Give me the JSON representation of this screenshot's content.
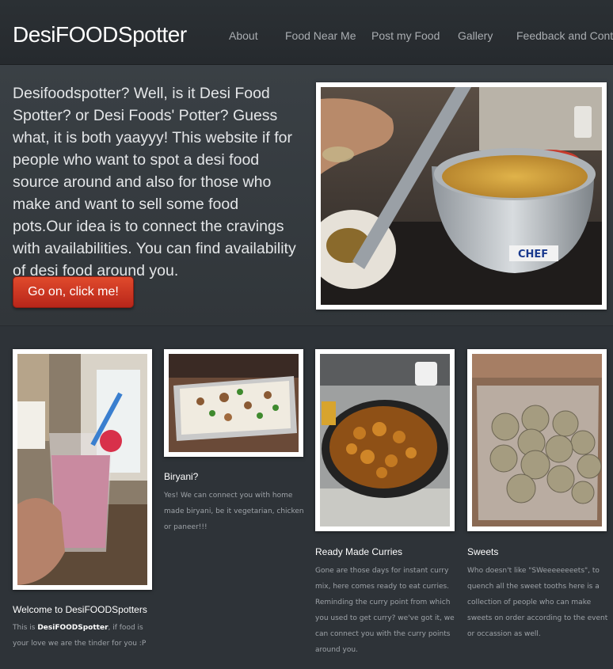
{
  "site": {
    "logo": "DesiFOODSpotter"
  },
  "nav": [
    {
      "label": "About"
    },
    {
      "label": "Food Near Me"
    },
    {
      "label": "Post my Food"
    },
    {
      "label": "Gallery"
    },
    {
      "label": "Feedback and Contact"
    }
  ],
  "banner": {
    "text": "Desifoodspotter? Well, is it Desi Food Spotter? or Desi Foods' Potter? Guess what, it is both yaayyy! This website if for people who want to spot a desi food source around and also for those who make and want to sell some food pots.Our idea is to connect the cravings with availabilities. You can find availability of desi food around you.",
    "button_label": "Go on, click me!",
    "photo_caption": "CHEF"
  },
  "cards": [
    {
      "title": "Welcome to DesiFOODSpotters",
      "text_before": "This is ",
      "text_bold": "DesiFOODSpotter",
      "text_after": ", if food is your love we are the tinder for you :P"
    },
    {
      "title": "Biryani?",
      "text": "Yes! We can connect you with home made biryani, be it vegetarian, chicken or paneer!!!"
    },
    {
      "title": "Ready Made Curries",
      "text": "Gone are those days for instant curry mix, here comes ready to eat curries. Reminding the curry point from which you used to get curry? we've got it, we can connect you with the curry points around you."
    },
    {
      "title": "Sweets",
      "text": "Who doesn't like \"SWeeeeeeeets\", to quench all the sweet tooths here is a collection of people who can make sweets on order according to the event or occassion as well."
    }
  ],
  "colors": {
    "background": "#2e3338",
    "button": "#d23a24",
    "title": "#ffffff",
    "body_text": "#9ea3a8"
  }
}
